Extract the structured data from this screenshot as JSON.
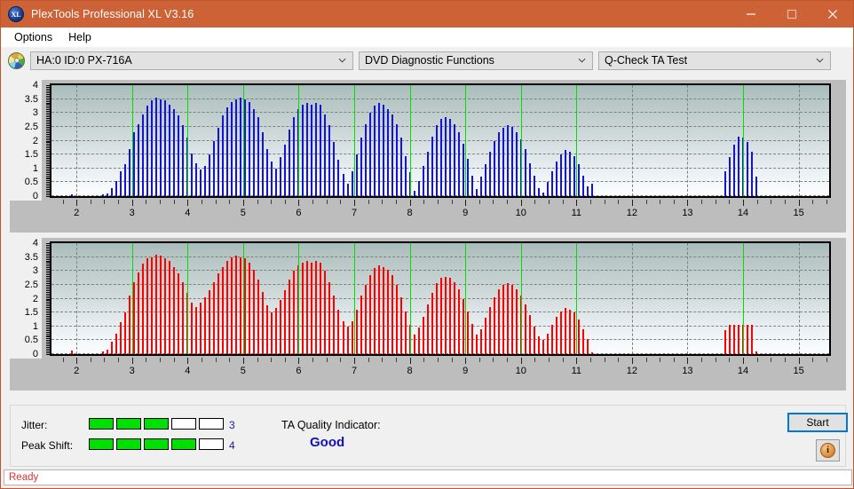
{
  "window": {
    "title": "PlexTools Professional XL V3.16",
    "app_icon": "xl-logo-icon",
    "minimize": "minimize-icon",
    "maximize": "maximize-icon",
    "close": "close-icon"
  },
  "menu": {
    "items": [
      {
        "label": "Options"
      },
      {
        "label": "Help"
      }
    ]
  },
  "toolbar": {
    "drive_icon": "optical-disc-icon",
    "drive": {
      "value": "HA:0 ID:0  PX-716A"
    },
    "function": {
      "value": "DVD Diagnostic Functions"
    },
    "test": {
      "value": "Q-Check TA Test"
    }
  },
  "results": {
    "jitter_label": "Jitter:",
    "jitter_value": "3",
    "jitter_filled": 3,
    "jitter_total": 5,
    "peak_shift_label": "Peak Shift:",
    "peak_shift_value": "4",
    "peak_shift_filled": 4,
    "peak_shift_total": 5,
    "ta_label": "TA Quality Indicator:",
    "ta_value": "Good",
    "start_label": "Start",
    "info_glyph": "i",
    "info_icon": "info-icon"
  },
  "statusbar": {
    "text": "Ready"
  },
  "colors": {
    "titlebar": "#cd6236",
    "bar_top": "#1414d2",
    "bar_bottom": "#ff0000",
    "marker": "#00e000",
    "meter_on": "#00e000",
    "ta_value": "#1010c0",
    "status_text": "#e03030",
    "accent_focus": "#0078d7"
  },
  "chart_data": [
    {
      "type": "bar",
      "id": "jitter-chart",
      "title": "",
      "series_name": "Jitter",
      "color": "#1414d2",
      "xlabel": "",
      "ylabel": "",
      "xlim": [
        1.55,
        15.55
      ],
      "ylim": [
        0,
        4
      ],
      "yticks": [
        0,
        0.5,
        1,
        1.5,
        2,
        2.5,
        3,
        3.5,
        4
      ],
      "ytick_labels": [
        "0",
        "0.5",
        "1",
        "1.5",
        "2",
        "2.5",
        "3",
        "3.5",
        "4"
      ],
      "xticks": [
        2,
        3,
        4,
        5,
        6,
        7,
        8,
        9,
        10,
        11,
        12,
        13,
        14,
        15
      ],
      "xtick_labels": [
        "2",
        "3",
        "4",
        "5",
        "6",
        "7",
        "8",
        "9",
        "10",
        "11",
        "12",
        "13",
        "14",
        "15"
      ],
      "grid": true,
      "markers_x": [
        3,
        4,
        5,
        6,
        7,
        8,
        9,
        10,
        11,
        14
      ],
      "x": [
        1.92,
        2.0,
        2.08,
        2.16,
        2.24,
        2.32,
        2.4,
        2.48,
        2.56,
        2.64,
        2.72,
        2.8,
        2.88,
        2.96,
        3.04,
        3.12,
        3.2,
        3.28,
        3.36,
        3.44,
        3.52,
        3.6,
        3.68,
        3.76,
        3.84,
        3.92,
        4.0,
        4.08,
        4.16,
        4.24,
        4.32,
        4.4,
        4.48,
        4.56,
        4.64,
        4.72,
        4.8,
        4.88,
        4.96,
        5.04,
        5.12,
        5.2,
        5.28,
        5.36,
        5.44,
        5.52,
        5.6,
        5.68,
        5.76,
        5.84,
        5.92,
        6.0,
        6.08,
        6.16,
        6.24,
        6.32,
        6.4,
        6.48,
        6.56,
        6.64,
        6.72,
        6.8,
        6.88,
        6.96,
        7.04,
        7.12,
        7.2,
        7.28,
        7.36,
        7.44,
        7.52,
        7.6,
        7.68,
        7.76,
        7.84,
        7.92,
        8.0,
        8.08,
        8.16,
        8.24,
        8.32,
        8.4,
        8.48,
        8.56,
        8.64,
        8.72,
        8.8,
        8.88,
        8.96,
        9.04,
        9.12,
        9.2,
        9.28,
        9.36,
        9.44,
        9.52,
        9.6,
        9.68,
        9.76,
        9.84,
        9.92,
        10.0,
        10.08,
        10.16,
        10.24,
        10.32,
        10.4,
        10.48,
        10.56,
        10.64,
        10.72,
        10.8,
        10.88,
        10.96,
        11.04,
        11.12,
        11.2,
        11.28,
        13.68,
        13.76,
        13.84,
        13.92,
        14.0,
        14.08,
        14.16,
        14.24,
        14.32
      ],
      "values": [
        0.08,
        0,
        0,
        0,
        0,
        0,
        0,
        0.07,
        0.1,
        0.3,
        0.55,
        0.9,
        1.15,
        1.7,
        2.3,
        2.6,
        2.95,
        3.25,
        3.45,
        3.55,
        3.5,
        3.45,
        3.3,
        3.15,
        2.9,
        2.55,
        2.1,
        1.55,
        1.2,
        0.95,
        1.1,
        1.5,
        2.0,
        2.45,
        2.9,
        3.2,
        3.4,
        3.5,
        3.55,
        3.5,
        3.4,
        3.15,
        2.85,
        2.3,
        1.7,
        1.25,
        1.0,
        1.4,
        1.85,
        2.4,
        2.85,
        3.15,
        3.3,
        3.35,
        3.3,
        3.35,
        3.3,
        2.95,
        2.55,
        1.95,
        1.3,
        0.8,
        0.45,
        0.9,
        1.5,
        2.1,
        2.6,
        3.0,
        3.25,
        3.35,
        3.3,
        3.15,
        2.95,
        2.6,
        2.1,
        1.45,
        0.85,
        0.2,
        0.55,
        1.1,
        1.6,
        2.15,
        2.55,
        2.8,
        2.85,
        2.8,
        2.6,
        2.3,
        1.9,
        1.35,
        0.75,
        0.25,
        0.7,
        1.15,
        1.6,
        2.0,
        2.3,
        2.45,
        2.55,
        2.5,
        2.3,
        2.05,
        1.7,
        1.2,
        0.75,
        0.3,
        0.12,
        0.5,
        0.9,
        1.25,
        1.5,
        1.65,
        1.6,
        1.45,
        1.15,
        0.75,
        0.35,
        0.45,
        0.9,
        1.4,
        1.85,
        2.15,
        2.1,
        1.95,
        1.6,
        0.7
      ]
    },
    {
      "type": "bar",
      "id": "peak-shift-chart",
      "title": "",
      "series_name": "Peak Shift",
      "color": "#ff0000",
      "xlabel": "",
      "ylabel": "",
      "xlim": [
        1.55,
        15.55
      ],
      "ylim": [
        0,
        4
      ],
      "yticks": [
        0,
        0.5,
        1,
        1.5,
        2,
        2.5,
        3,
        3.5,
        4
      ],
      "ytick_labels": [
        "0",
        "0.5",
        "1",
        "1.5",
        "2",
        "2.5",
        "3",
        "3.5",
        "4"
      ],
      "xticks": [
        2,
        3,
        4,
        5,
        6,
        7,
        8,
        9,
        10,
        11,
        12,
        13,
        14,
        15
      ],
      "xtick_labels": [
        "2",
        "3",
        "4",
        "5",
        "6",
        "7",
        "8",
        "9",
        "10",
        "11",
        "12",
        "13",
        "14",
        "15"
      ],
      "grid": true,
      "markers_x": [
        3,
        4,
        5,
        6,
        7,
        8,
        9,
        10,
        11,
        14
      ],
      "x": [
        1.92,
        2.0,
        2.08,
        2.16,
        2.24,
        2.32,
        2.4,
        2.48,
        2.56,
        2.64,
        2.72,
        2.8,
        2.88,
        2.96,
        3.04,
        3.12,
        3.2,
        3.28,
        3.36,
        3.44,
        3.52,
        3.6,
        3.68,
        3.76,
        3.84,
        3.92,
        4.0,
        4.08,
        4.16,
        4.24,
        4.32,
        4.4,
        4.48,
        4.56,
        4.64,
        4.72,
        4.8,
        4.88,
        4.96,
        5.04,
        5.12,
        5.2,
        5.28,
        5.36,
        5.44,
        5.52,
        5.6,
        5.68,
        5.76,
        5.84,
        5.92,
        6.0,
        6.08,
        6.16,
        6.24,
        6.32,
        6.4,
        6.48,
        6.56,
        6.64,
        6.72,
        6.8,
        6.88,
        6.96,
        7.04,
        7.12,
        7.2,
        7.28,
        7.36,
        7.44,
        7.52,
        7.6,
        7.68,
        7.76,
        7.84,
        7.92,
        8.0,
        8.08,
        8.16,
        8.24,
        8.32,
        8.4,
        8.48,
        8.56,
        8.64,
        8.72,
        8.8,
        8.88,
        8.96,
        9.04,
        9.12,
        9.2,
        9.28,
        9.36,
        9.44,
        9.52,
        9.6,
        9.68,
        9.76,
        9.84,
        9.92,
        10.0,
        10.08,
        10.16,
        10.24,
        10.32,
        10.4,
        10.48,
        10.56,
        10.64,
        10.72,
        10.8,
        10.88,
        10.96,
        11.04,
        11.12,
        11.2,
        11.28,
        13.68,
        13.76,
        13.84,
        13.92,
        14.0,
        14.08,
        14.16,
        14.24,
        14.32
      ],
      "values": [
        0.12,
        0,
        0,
        0,
        0,
        0,
        0,
        0.1,
        0.15,
        0.45,
        0.75,
        1.15,
        1.5,
        2.1,
        2.6,
        2.95,
        3.25,
        3.45,
        3.5,
        3.6,
        3.55,
        3.45,
        3.35,
        3.15,
        2.9,
        2.6,
        2.2,
        1.85,
        1.7,
        1.85,
        2.05,
        2.3,
        2.6,
        2.9,
        3.15,
        3.35,
        3.5,
        3.55,
        3.5,
        3.45,
        3.3,
        3.05,
        2.7,
        2.25,
        1.75,
        1.5,
        1.65,
        1.95,
        2.3,
        2.7,
        3.0,
        3.2,
        3.3,
        3.35,
        3.3,
        3.35,
        3.3,
        3.0,
        2.6,
        2.1,
        1.6,
        1.2,
        1.0,
        1.2,
        1.6,
        2.1,
        2.5,
        2.85,
        3.1,
        3.2,
        3.15,
        3.05,
        2.85,
        2.5,
        2.05,
        1.55,
        1.05,
        0.7,
        0.95,
        1.35,
        1.8,
        2.2,
        2.55,
        2.75,
        2.8,
        2.75,
        2.6,
        2.35,
        2.0,
        1.55,
        1.1,
        0.7,
        0.9,
        1.3,
        1.7,
        2.05,
        2.35,
        2.5,
        2.55,
        2.5,
        2.35,
        2.1,
        1.8,
        1.4,
        1.0,
        0.65,
        0.5,
        0.75,
        1.05,
        1.35,
        1.55,
        1.65,
        1.6,
        1.5,
        1.25,
        0.9,
        0.55,
        0.05,
        0.85,
        1.05,
        1.05,
        1.05,
        1.05,
        1.05,
        1.05,
        0.1
      ]
    }
  ]
}
